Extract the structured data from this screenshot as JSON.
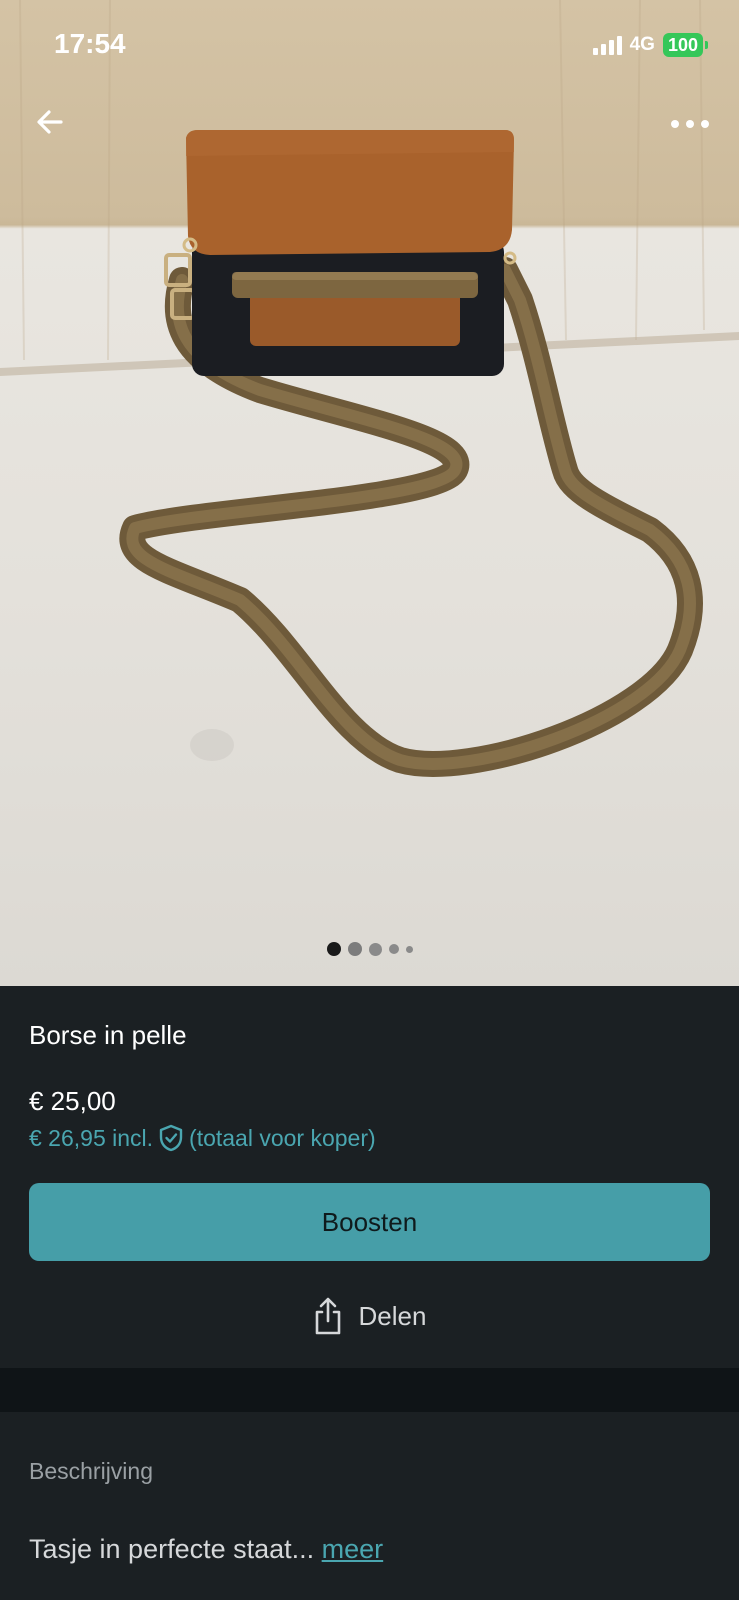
{
  "status_bar": {
    "time": "17:54",
    "network": "4G",
    "battery": "100"
  },
  "photo": {
    "description_icon": "product-photo",
    "pager": {
      "total": 5,
      "active_index": 0
    }
  },
  "listing": {
    "title": "Borse in pelle",
    "price": "€ 25,00",
    "price_incl": "€ 26,95 incl.",
    "price_incl_suffix": "(totaal voor koper)",
    "boost_label": "Boosten",
    "share_label": "Delen"
  },
  "description": {
    "heading": "Beschrijving",
    "text": "Tasje in perfecte staat... ",
    "more_label": "meer"
  },
  "colors": {
    "accent": "#469ea8",
    "accent_text": "#4aa6b0",
    "panel": "#1b2023",
    "background": "#0f1417",
    "battery": "#35c759"
  }
}
